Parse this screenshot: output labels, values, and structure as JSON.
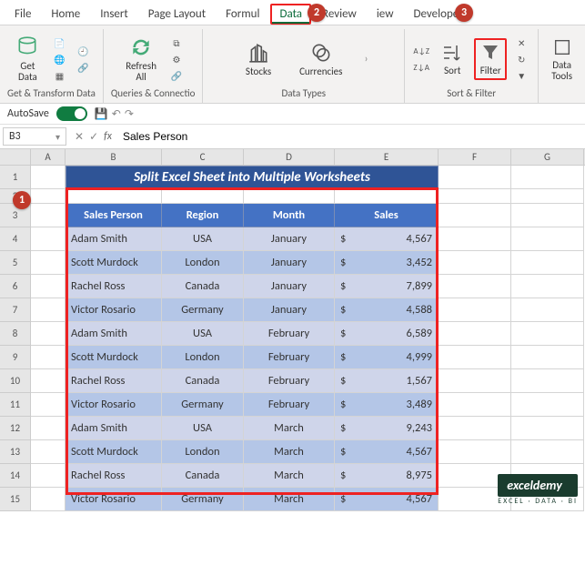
{
  "tabs": {
    "file": "File",
    "home": "Home",
    "insert": "Insert",
    "pagelayout": "Page Layout",
    "formulas": "Formul",
    "data": "Data",
    "review": "Review",
    "view": "iew",
    "developer": "Developer"
  },
  "ribbon": {
    "getdata": "Get\nData",
    "refresh": "Refresh\nAll",
    "stocks": "Stocks",
    "currencies": "Currencies",
    "sort": "Sort",
    "filter": "Filter",
    "datatools": "Data\nTools",
    "groups": {
      "transform": "Get & Transform Data",
      "queries": "Queries & Connectio",
      "types": "Data Types",
      "sortfilter": "Sort & Filter"
    }
  },
  "autosave": "AutoSave",
  "namebox": "B3",
  "fx": "fx",
  "formula_value": "Sales Person",
  "cols": [
    "A",
    "B",
    "C",
    "D",
    "E",
    "F",
    "G"
  ],
  "title": "Split Excel Sheet into Multiple Worksheets",
  "headers": {
    "person": "Sales Person",
    "region": "Region",
    "month": "Month",
    "sales": "Sales"
  },
  "currency": "$",
  "rows": [
    {
      "person": "Adam Smith",
      "region": "USA",
      "month": "January",
      "sales": "4,567"
    },
    {
      "person": "Scott Murdock",
      "region": "London",
      "month": "January",
      "sales": "3,452"
    },
    {
      "person": "Rachel Ross",
      "region": "Canada",
      "month": "January",
      "sales": "7,899"
    },
    {
      "person": "Victor Rosario",
      "region": "Germany",
      "month": "January",
      "sales": "4,588"
    },
    {
      "person": "Adam Smith",
      "region": "USA",
      "month": "February",
      "sales": "6,589"
    },
    {
      "person": "Scott Murdock",
      "region": "London",
      "month": "February",
      "sales": "4,999"
    },
    {
      "person": "Rachel Ross",
      "region": "Canada",
      "month": "February",
      "sales": "1,567"
    },
    {
      "person": "Victor Rosario",
      "region": "Germany",
      "month": "February",
      "sales": "3,489"
    },
    {
      "person": "Adam Smith",
      "region": "USA",
      "month": "March",
      "sales": "9,243"
    },
    {
      "person": "Scott Murdock",
      "region": "London",
      "month": "March",
      "sales": "4,567"
    },
    {
      "person": "Rachel Ross",
      "region": "Canada",
      "month": "March",
      "sales": "8,975"
    },
    {
      "person": "Victor Rosario",
      "region": "Germany",
      "month": "March",
      "sales": "4,567"
    }
  ],
  "badges": {
    "one": "1",
    "two": "2",
    "three": "3"
  },
  "watermark": {
    "main": "exceldemy",
    "sub": "EXCEL · DATA · BI"
  }
}
